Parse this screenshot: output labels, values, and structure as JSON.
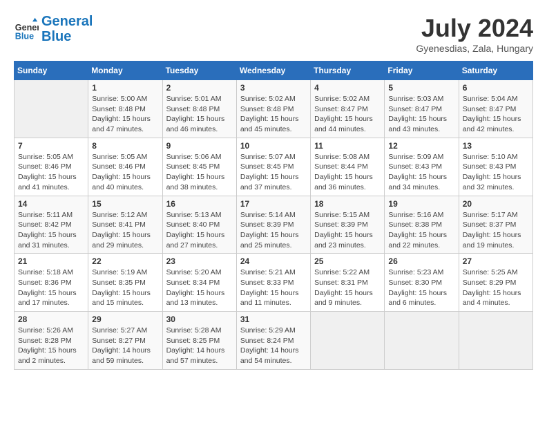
{
  "header": {
    "logo_line1": "General",
    "logo_line2": "Blue",
    "month_title": "July 2024",
    "location": "Gyenesdias, Zala, Hungary"
  },
  "days_of_week": [
    "Sunday",
    "Monday",
    "Tuesday",
    "Wednesday",
    "Thursday",
    "Friday",
    "Saturday"
  ],
  "weeks": [
    [
      {
        "day": "",
        "info": ""
      },
      {
        "day": "1",
        "info": "Sunrise: 5:00 AM\nSunset: 8:48 PM\nDaylight: 15 hours and 47 minutes."
      },
      {
        "day": "2",
        "info": "Sunrise: 5:01 AM\nSunset: 8:48 PM\nDaylight: 15 hours and 46 minutes."
      },
      {
        "day": "3",
        "info": "Sunrise: 5:02 AM\nSunset: 8:48 PM\nDaylight: 15 hours and 45 minutes."
      },
      {
        "day": "4",
        "info": "Sunrise: 5:02 AM\nSunset: 8:47 PM\nDaylight: 15 hours and 44 minutes."
      },
      {
        "day": "5",
        "info": "Sunrise: 5:03 AM\nSunset: 8:47 PM\nDaylight: 15 hours and 43 minutes."
      },
      {
        "day": "6",
        "info": "Sunrise: 5:04 AM\nSunset: 8:47 PM\nDaylight: 15 hours and 42 minutes."
      }
    ],
    [
      {
        "day": "7",
        "info": "Sunrise: 5:05 AM\nSunset: 8:46 PM\nDaylight: 15 hours and 41 minutes."
      },
      {
        "day": "8",
        "info": "Sunrise: 5:05 AM\nSunset: 8:46 PM\nDaylight: 15 hours and 40 minutes."
      },
      {
        "day": "9",
        "info": "Sunrise: 5:06 AM\nSunset: 8:45 PM\nDaylight: 15 hours and 38 minutes."
      },
      {
        "day": "10",
        "info": "Sunrise: 5:07 AM\nSunset: 8:45 PM\nDaylight: 15 hours and 37 minutes."
      },
      {
        "day": "11",
        "info": "Sunrise: 5:08 AM\nSunset: 8:44 PM\nDaylight: 15 hours and 36 minutes."
      },
      {
        "day": "12",
        "info": "Sunrise: 5:09 AM\nSunset: 8:43 PM\nDaylight: 15 hours and 34 minutes."
      },
      {
        "day": "13",
        "info": "Sunrise: 5:10 AM\nSunset: 8:43 PM\nDaylight: 15 hours and 32 minutes."
      }
    ],
    [
      {
        "day": "14",
        "info": "Sunrise: 5:11 AM\nSunset: 8:42 PM\nDaylight: 15 hours and 31 minutes."
      },
      {
        "day": "15",
        "info": "Sunrise: 5:12 AM\nSunset: 8:41 PM\nDaylight: 15 hours and 29 minutes."
      },
      {
        "day": "16",
        "info": "Sunrise: 5:13 AM\nSunset: 8:40 PM\nDaylight: 15 hours and 27 minutes."
      },
      {
        "day": "17",
        "info": "Sunrise: 5:14 AM\nSunset: 8:39 PM\nDaylight: 15 hours and 25 minutes."
      },
      {
        "day": "18",
        "info": "Sunrise: 5:15 AM\nSunset: 8:39 PM\nDaylight: 15 hours and 23 minutes."
      },
      {
        "day": "19",
        "info": "Sunrise: 5:16 AM\nSunset: 8:38 PM\nDaylight: 15 hours and 22 minutes."
      },
      {
        "day": "20",
        "info": "Sunrise: 5:17 AM\nSunset: 8:37 PM\nDaylight: 15 hours and 19 minutes."
      }
    ],
    [
      {
        "day": "21",
        "info": "Sunrise: 5:18 AM\nSunset: 8:36 PM\nDaylight: 15 hours and 17 minutes."
      },
      {
        "day": "22",
        "info": "Sunrise: 5:19 AM\nSunset: 8:35 PM\nDaylight: 15 hours and 15 minutes."
      },
      {
        "day": "23",
        "info": "Sunrise: 5:20 AM\nSunset: 8:34 PM\nDaylight: 15 hours and 13 minutes."
      },
      {
        "day": "24",
        "info": "Sunrise: 5:21 AM\nSunset: 8:33 PM\nDaylight: 15 hours and 11 minutes."
      },
      {
        "day": "25",
        "info": "Sunrise: 5:22 AM\nSunset: 8:31 PM\nDaylight: 15 hours and 9 minutes."
      },
      {
        "day": "26",
        "info": "Sunrise: 5:23 AM\nSunset: 8:30 PM\nDaylight: 15 hours and 6 minutes."
      },
      {
        "day": "27",
        "info": "Sunrise: 5:25 AM\nSunset: 8:29 PM\nDaylight: 15 hours and 4 minutes."
      }
    ],
    [
      {
        "day": "28",
        "info": "Sunrise: 5:26 AM\nSunset: 8:28 PM\nDaylight: 15 hours and 2 minutes."
      },
      {
        "day": "29",
        "info": "Sunrise: 5:27 AM\nSunset: 8:27 PM\nDaylight: 14 hours and 59 minutes."
      },
      {
        "day": "30",
        "info": "Sunrise: 5:28 AM\nSunset: 8:25 PM\nDaylight: 14 hours and 57 minutes."
      },
      {
        "day": "31",
        "info": "Sunrise: 5:29 AM\nSunset: 8:24 PM\nDaylight: 14 hours and 54 minutes."
      },
      {
        "day": "",
        "info": ""
      },
      {
        "day": "",
        "info": ""
      },
      {
        "day": "",
        "info": ""
      }
    ]
  ]
}
